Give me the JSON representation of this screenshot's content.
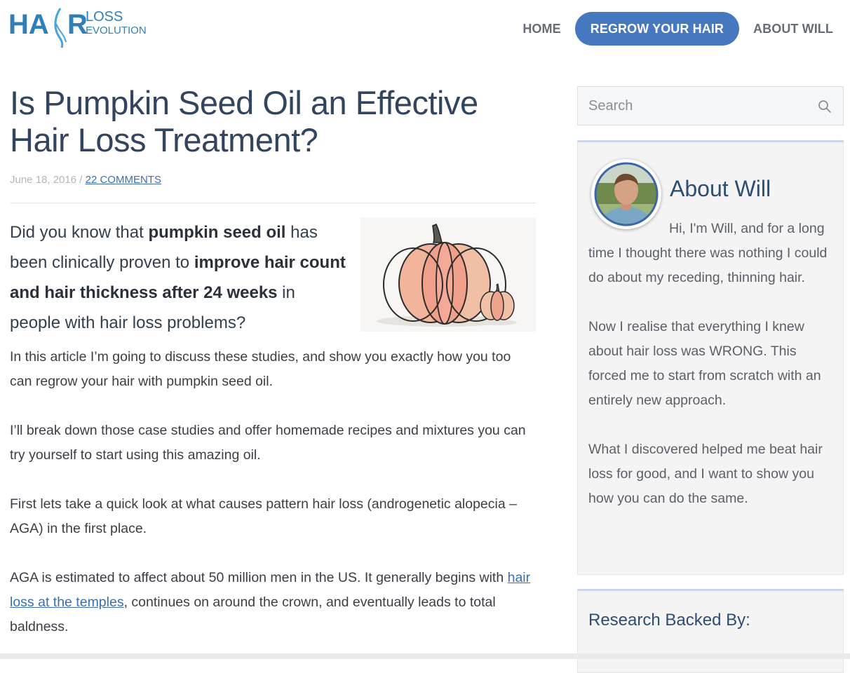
{
  "logo": {
    "hair": "HA",
    "r": "R",
    "loss": "LOSS",
    "evolution": "EVOLUTION"
  },
  "nav": {
    "items": [
      {
        "label": "HOME"
      },
      {
        "label": "REGROW YOUR HAIR"
      },
      {
        "label": "ABOUT WILL"
      }
    ]
  },
  "article": {
    "title": "Is Pumpkin Seed Oil an Effective Hair Loss Treatment?",
    "date": "June 18, 2016",
    "separator": " / ",
    "comments": "22 COMMENTS",
    "intro": {
      "t1": "Did you know that ",
      "b1": "pumpkin seed oil",
      "t2": " has been clinically proven to ",
      "b2": "improve hair count and hair thickness after 24 weeks",
      "t3": " in people with hair loss problems?"
    },
    "paragraphs": [
      "In this article I’m going to discuss these studies, and show you exactly how you too can regrow your hair with pumpkin seed oil.",
      "I’ll break down those case studies and offer homemade recipes and mixtures you can try yourself to start using this amazing oil.",
      "First lets take a quick look at what causes pattern hair loss (androgenetic alopecia – AGA) in the first place."
    ],
    "last_paragraph": {
      "before": "AGA is estimated to affect about 50 million men in the US. It generally begins with ",
      "link": "hair loss at the temples",
      "after": ", continues on around the crown, and eventually leads to total baldness."
    }
  },
  "sidebar": {
    "search_placeholder": "Search",
    "about": {
      "title": "About Will",
      "paragraphs": [
        "Hi, I'm Will, and for a long time I thought there was nothing I could do about my receding, thinning hair.",
        "Now I realise that everything I knew about hair loss was WRONG. This forced me to start from scratch with an entirely new approach.",
        "What I discovered helped me beat hair loss for good, and I want to show you how you can do the same."
      ]
    },
    "research_title": "Research Backed By:"
  },
  "colors": {
    "accent": "#4678c0",
    "title": "#33445e",
    "link": "#3b6fb0",
    "widget_title": "#2e4d73"
  }
}
